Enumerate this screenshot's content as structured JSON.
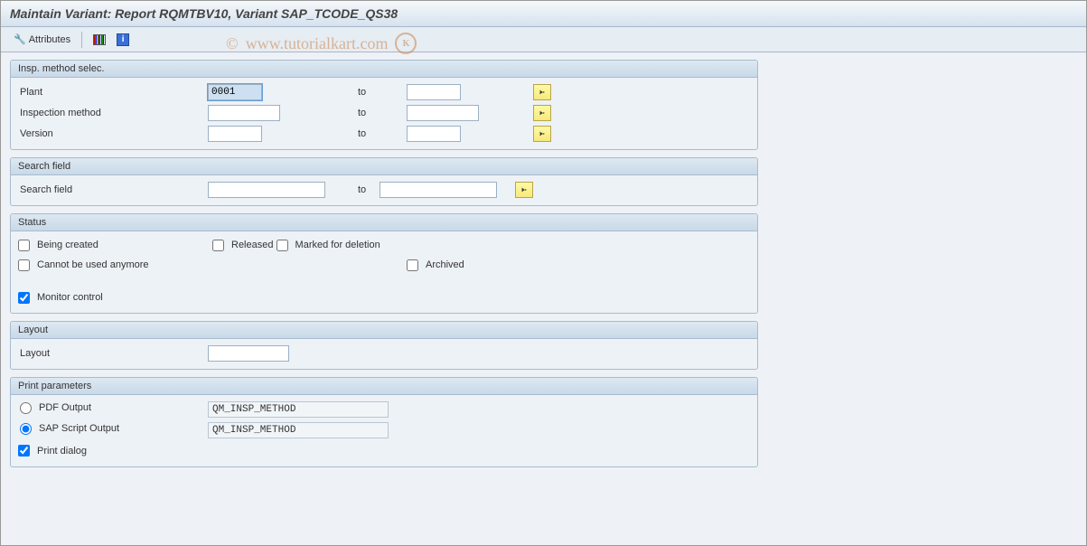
{
  "title": "Maintain Variant: Report RQMTBV10, Variant SAP_TCODE_QS38",
  "toolbar": {
    "attributes": "Attributes",
    "info_char": "i"
  },
  "watermark": {
    "c": "©",
    "text": "www.tutorialkart.com",
    "k": "K"
  },
  "groups": {
    "insp": {
      "title": "Insp. method selec.",
      "plant_lbl": "Plant",
      "plant_val": "0001",
      "plant_to": "to",
      "im_lbl": "Inspection method",
      "im_to": "to",
      "ver_lbl": "Version",
      "ver_to": "to"
    },
    "search": {
      "title": "Search field",
      "lbl": "Search field",
      "to": "to"
    },
    "status": {
      "title": "Status",
      "being_created": "Being created",
      "released": "Released",
      "cannot_use": "Cannot be used anymore",
      "marked_del": "Marked for deletion",
      "archived": "Archived",
      "monitor": "Monitor control"
    },
    "layout": {
      "title": "Layout",
      "lbl": "Layout"
    },
    "print": {
      "title": "Print parameters",
      "pdf": "PDF Output",
      "pdf_val": "QM_INSP_METHOD",
      "sap": "SAP Script Output",
      "sap_val": "QM_INSP_METHOD",
      "dialog": "Print dialog"
    }
  }
}
